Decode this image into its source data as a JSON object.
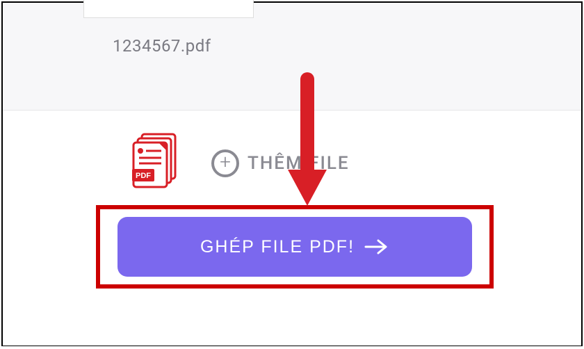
{
  "file": {
    "name": "1234567.pdf"
  },
  "actions": {
    "add_file_label": "THÊM FILE",
    "merge_label": "GHÉP FILE PDF!"
  }
}
